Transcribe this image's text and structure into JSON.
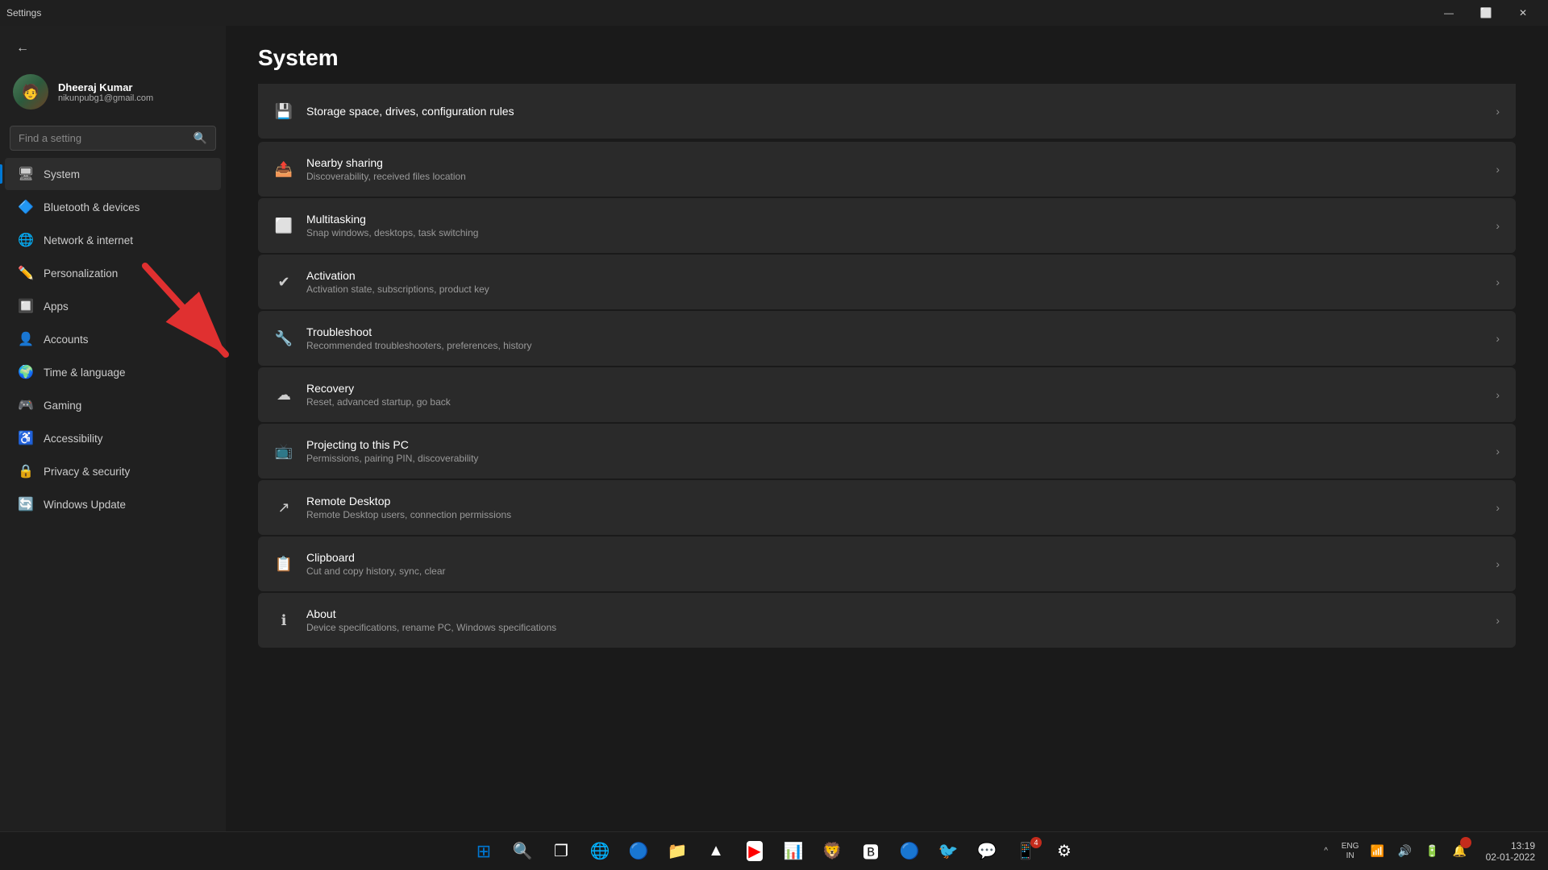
{
  "window": {
    "title": "Settings",
    "controls": {
      "minimize": "—",
      "maximize": "⬜",
      "close": "✕"
    }
  },
  "sidebar": {
    "back_icon": "←",
    "user": {
      "name": "Dheeraj Kumar",
      "email": "nikunpubg1@gmail.com"
    },
    "search_placeholder": "Find a setting",
    "nav_items": [
      {
        "id": "system",
        "label": "System",
        "icon": "🖥",
        "active": true
      },
      {
        "id": "bluetooth",
        "label": "Bluetooth & devices",
        "icon": "🔷",
        "active": false
      },
      {
        "id": "network",
        "label": "Network & internet",
        "icon": "🌐",
        "active": false
      },
      {
        "id": "personalization",
        "label": "Personalization",
        "icon": "✏️",
        "active": false
      },
      {
        "id": "apps",
        "label": "Apps",
        "icon": "🔲",
        "active": false
      },
      {
        "id": "accounts",
        "label": "Accounts",
        "icon": "👤",
        "active": false
      },
      {
        "id": "time",
        "label": "Time & language",
        "icon": "🌍",
        "active": false
      },
      {
        "id": "gaming",
        "label": "Gaming",
        "icon": "🎮",
        "active": false
      },
      {
        "id": "accessibility",
        "label": "Accessibility",
        "icon": "♿",
        "active": false
      },
      {
        "id": "privacy",
        "label": "Privacy & security",
        "icon": "🔒",
        "active": false
      },
      {
        "id": "update",
        "label": "Windows Update",
        "icon": "🔄",
        "active": false
      }
    ]
  },
  "main": {
    "page_title": "System",
    "settings_items": [
      {
        "id": "storage",
        "title": "Storage space, drives, configuration rules",
        "desc": "",
        "icon": "💾",
        "partial": true
      },
      {
        "id": "nearby-sharing",
        "title": "Nearby sharing",
        "desc": "Discoverability, received files location",
        "icon": "📤"
      },
      {
        "id": "multitasking",
        "title": "Multitasking",
        "desc": "Snap windows, desktops, task switching",
        "icon": "⬜"
      },
      {
        "id": "activation",
        "title": "Activation",
        "desc": "Activation state, subscriptions, product key",
        "icon": "✔"
      },
      {
        "id": "troubleshoot",
        "title": "Troubleshoot",
        "desc": "Recommended troubleshooters, preferences, history",
        "icon": "🔧"
      },
      {
        "id": "recovery",
        "title": "Recovery",
        "desc": "Reset, advanced startup, go back",
        "icon": "☁"
      },
      {
        "id": "projecting",
        "title": "Projecting to this PC",
        "desc": "Permissions, pairing PIN, discoverability",
        "icon": "📺"
      },
      {
        "id": "remote-desktop",
        "title": "Remote Desktop",
        "desc": "Remote Desktop users, connection permissions",
        "icon": "↗"
      },
      {
        "id": "clipboard",
        "title": "Clipboard",
        "desc": "Cut and copy history, sync, clear",
        "icon": "📋"
      },
      {
        "id": "about",
        "title": "About",
        "desc": "Device specifications, rename PC, Windows specifications",
        "icon": "ℹ"
      }
    ]
  },
  "taskbar": {
    "apps": [
      {
        "id": "start",
        "icon": "⊞",
        "label": "Start"
      },
      {
        "id": "search",
        "icon": "🔍",
        "label": "Search"
      },
      {
        "id": "taskview",
        "icon": "❐",
        "label": "Task View"
      },
      {
        "id": "edge",
        "icon": "🌐",
        "label": "Microsoft Edge"
      },
      {
        "id": "chrome",
        "icon": "🔵",
        "label": "Chrome"
      },
      {
        "id": "fileexplorer",
        "icon": "📁",
        "label": "File Explorer"
      },
      {
        "id": "drive",
        "icon": "▲",
        "label": "Google Drive"
      },
      {
        "id": "youtube",
        "icon": "▶",
        "label": "YouTube"
      },
      {
        "id": "sheets",
        "icon": "📊",
        "label": "Google Sheets"
      },
      {
        "id": "brave",
        "icon": "🦁",
        "label": "Brave"
      },
      {
        "id": "bit",
        "icon": "🅱",
        "label": "BitBrowser"
      },
      {
        "id": "browser2",
        "icon": "🔵",
        "label": "Browser"
      },
      {
        "id": "twitter",
        "icon": "🐦",
        "label": "Twitter"
      },
      {
        "id": "discord",
        "icon": "💬",
        "label": "Discord"
      },
      {
        "id": "whatsapp",
        "icon": "💚",
        "label": "WhatsApp"
      },
      {
        "id": "settings-app",
        "icon": "⚙",
        "label": "Settings"
      }
    ],
    "tray": {
      "hidden_icon": "^",
      "lang": "ENG\nIN",
      "wifi": "📶",
      "sound": "🔊",
      "battery": "🔋",
      "notification": "🔔",
      "time": "13:19",
      "date": "02-01-2022"
    }
  }
}
